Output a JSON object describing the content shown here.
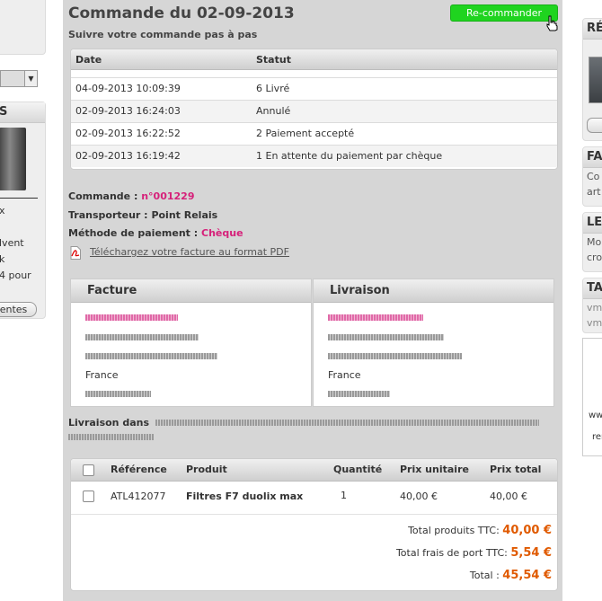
{
  "left_sidebar": {
    "select_value": "",
    "box_title": "S",
    "text_lines": [
      "x",
      "lvent",
      "k",
      "4 pour"
    ],
    "button_label": "entes"
  },
  "page": {
    "title": "Commande du 02-09-2013",
    "reorder_label": "Re-commander",
    "subtitle": "Suivre votre commande pas à pas"
  },
  "status_table": {
    "columns": [
      "Date",
      "Statut"
    ],
    "rows": [
      {
        "date": "04-09-2013 10:09:39",
        "status": "6 Livré"
      },
      {
        "date": "02-09-2013 16:24:03",
        "status": "Annulé"
      },
      {
        "date": "02-09-2013 16:22:52",
        "status": "2 Paiement accepté"
      },
      {
        "date": "02-09-2013 16:19:42",
        "status": "1 En attente du paiement par chèque"
      }
    ]
  },
  "order_info": {
    "order_label": "Commande :",
    "order_number": "n°001229",
    "carrier_label": "Transporteur :",
    "carrier_value": "Point Relais",
    "payment_label": "Méthode de paiement :",
    "payment_value": "Chèque",
    "pdf_link": "Téléchargez votre facture au format PDF"
  },
  "addresses": {
    "invoice_title": "Facture",
    "delivery_title": "Livraison",
    "invoice_country": "France",
    "delivery_country": "France"
  },
  "delivery_note": {
    "label": "Livraison dans "
  },
  "products_table": {
    "columns": [
      "Référence",
      "Produit",
      "Quantité",
      "Prix unitaire",
      "Prix total"
    ],
    "rows": [
      {
        "reference": "ATL412077",
        "product": "Filtres F7 duolix max",
        "quantity": "1",
        "unit_price": "40,00 €",
        "total_price": "40,00 €"
      }
    ]
  },
  "totals": {
    "products_label": "Total produits TTC:",
    "products_value": "40,00 €",
    "shipping_label": "Total frais de port TTC:",
    "shipping_value": "5,54 €",
    "total_label": "Total :",
    "total_value": "45,54 €"
  },
  "right_sidebar": {
    "boxes": [
      {
        "title": "RÉ",
        "lines": []
      },
      {
        "title": "FA",
        "lines": [
          "Co",
          "art"
        ]
      },
      {
        "title": "LE",
        "lines": [
          "Mo",
          "cro"
        ]
      },
      {
        "title": "TA",
        "lines": [
          "vm",
          "vm"
        ]
      }
    ],
    "misc": [
      "ww",
      "rer"
    ]
  },
  "colors": {
    "accent_pink": "#d6217a",
    "accent_orange": "#e05a00",
    "reorder_green": "#1fd41f"
  }
}
